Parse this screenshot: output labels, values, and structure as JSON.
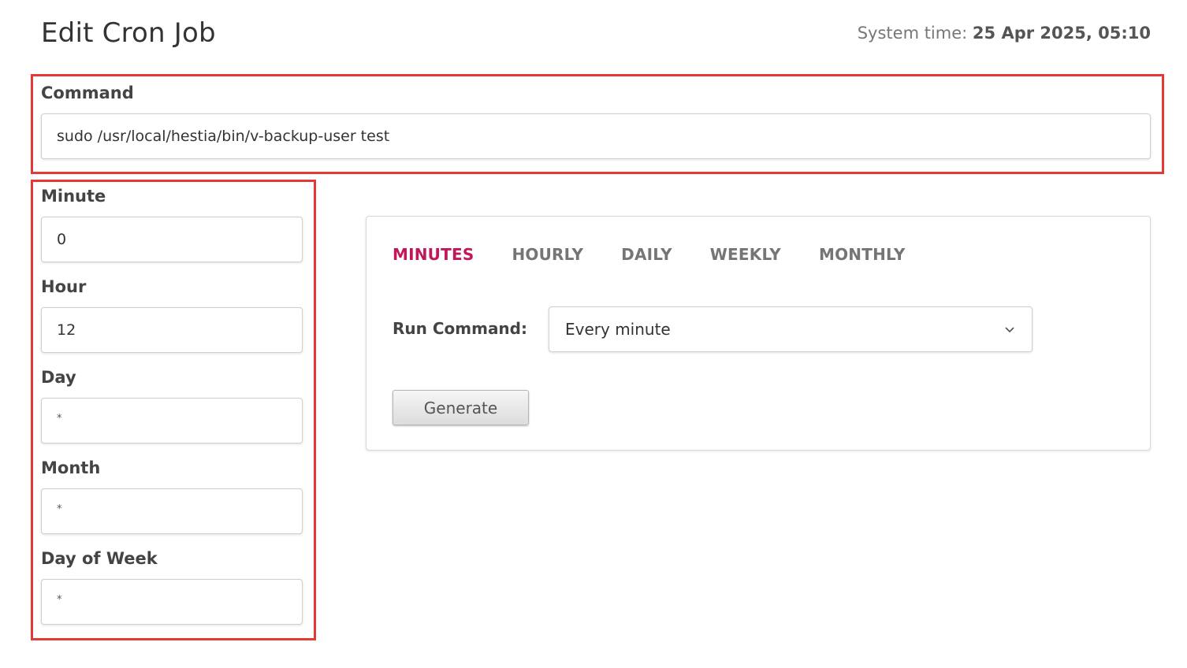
{
  "header": {
    "title": "Edit Cron Job",
    "system_time_label": "System time:",
    "system_time_value": "25 Apr 2025, 05:10"
  },
  "command": {
    "label": "Command",
    "value": "sudo /usr/local/hestia/bin/v-backup-user test"
  },
  "schedule": {
    "minute": {
      "label": "Minute",
      "value": "0"
    },
    "hour": {
      "label": "Hour",
      "value": "12"
    },
    "day": {
      "label": "Day",
      "value": "*"
    },
    "month": {
      "label": "Month",
      "value": "*"
    },
    "day_of_week": {
      "label": "Day of Week",
      "value": "*"
    }
  },
  "generator": {
    "tabs": [
      {
        "label": "MINUTES",
        "active": true
      },
      {
        "label": "HOURLY",
        "active": false
      },
      {
        "label": "DAILY",
        "active": false
      },
      {
        "label": "WEEKLY",
        "active": false
      },
      {
        "label": "MONTHLY",
        "active": false
      }
    ],
    "run_label": "Run Command:",
    "run_value": "Every minute",
    "generate_label": "Generate"
  },
  "colors": {
    "highlight": "#e53935",
    "active_tab": "#c2185b"
  },
  "icons": {
    "select_chevron": "chevron-down-icon"
  }
}
